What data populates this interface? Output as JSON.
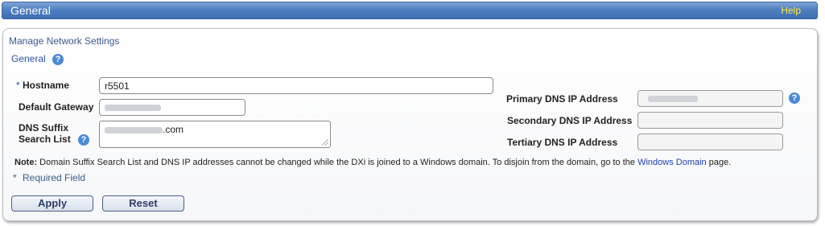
{
  "header": {
    "title": "General",
    "help_label": "Help"
  },
  "breadcrumb": "Manage Network Settings",
  "section": {
    "title": "General",
    "help_icon": "question-icon"
  },
  "form": {
    "hostname": {
      "required_mark": "*",
      "label": "Hostname",
      "value": "r5501"
    },
    "default_gateway": {
      "label": "Default Gateway",
      "value": ""
    },
    "dns_suffix": {
      "label_line1": "DNS Suffix",
      "label_line2": "Search List",
      "value_suffix": ".com"
    },
    "primary_dns": {
      "label": "Primary DNS IP Address",
      "value": ""
    },
    "secondary_dns": {
      "label": "Secondary DNS IP Address",
      "value": ""
    },
    "tertiary_dns": {
      "label": "Tertiary DNS IP Address",
      "value": ""
    }
  },
  "note": {
    "prefix": "Note:",
    "text": " Domain Suffix Search List and DNS IP addresses cannot be changed while the DXi is joined to a Windows domain. To disjoin from the domain, go to the ",
    "link": "Windows Domain",
    "suffix": " page."
  },
  "required_field": {
    "mark": "*",
    "label": "Required Field"
  },
  "buttons": {
    "apply": "Apply",
    "reset": "Reset"
  },
  "colors": {
    "accent": "#3d6fb4",
    "help_text": "#ffea4a",
    "link": "#1a3fb0"
  }
}
